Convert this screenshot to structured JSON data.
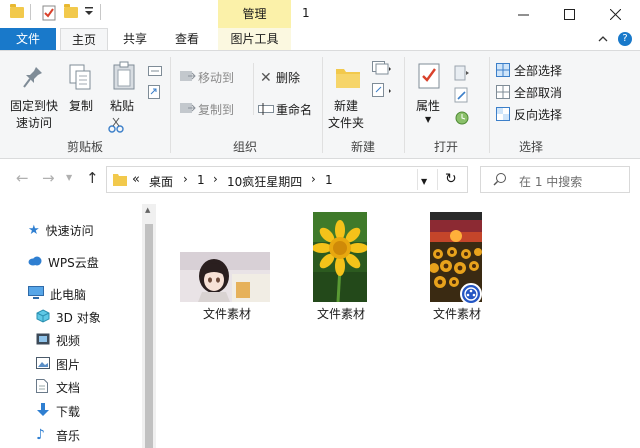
{
  "titlebar": {
    "context_tab": "管理",
    "window_title": "1"
  },
  "tabs": {
    "file": "文件",
    "home": "主页",
    "share": "共享",
    "view": "查看",
    "picture_tools": "图片工具"
  },
  "ribbon": {
    "clipboard": {
      "pin_label_1": "固定到快",
      "pin_label_2": "速访问",
      "copy": "复制",
      "paste": "粘贴",
      "group": "剪贴板"
    },
    "organize": {
      "move_to": "移动到",
      "copy_to": "复制到",
      "delete": "删除",
      "rename": "重命名",
      "group": "组织"
    },
    "new": {
      "new_folder_1": "新建",
      "new_folder_2": "文件夹",
      "group": "新建"
    },
    "open": {
      "properties": "属性",
      "group": "打开"
    },
    "select": {
      "select_all": "全部选择",
      "select_none": "全部取消",
      "invert": "反向选择",
      "group": "选择"
    }
  },
  "address": {
    "prefix": "«",
    "crumbs": [
      "桌面",
      "1",
      "10疯狂星期四",
      "1"
    ],
    "search_placeholder": "在 1 中搜索"
  },
  "nav": [
    {
      "label": "快速访问",
      "icon": "star-icon"
    },
    {
      "label": "WPS云盘",
      "icon": "cloud-icon"
    },
    {
      "label": "此电脑",
      "icon": "computer-icon"
    },
    {
      "label": "3D 对象",
      "icon": "cube-icon"
    },
    {
      "label": "视频",
      "icon": "video-icon"
    },
    {
      "label": "图片",
      "icon": "picture-icon"
    },
    {
      "label": "文档",
      "icon": "document-icon"
    },
    {
      "label": "下载",
      "icon": "download-icon"
    },
    {
      "label": "音乐",
      "icon": "music-icon"
    }
  ],
  "files": [
    {
      "name": "文件素材",
      "kind": "anime-image"
    },
    {
      "name": "文件素材",
      "kind": "flower-image"
    },
    {
      "name": "文件素材",
      "kind": "video-thumbnail"
    }
  ],
  "colors": {
    "accent": "#1979ca",
    "context_tab": "#fbf1a9",
    "folder": "#f2c94c"
  }
}
